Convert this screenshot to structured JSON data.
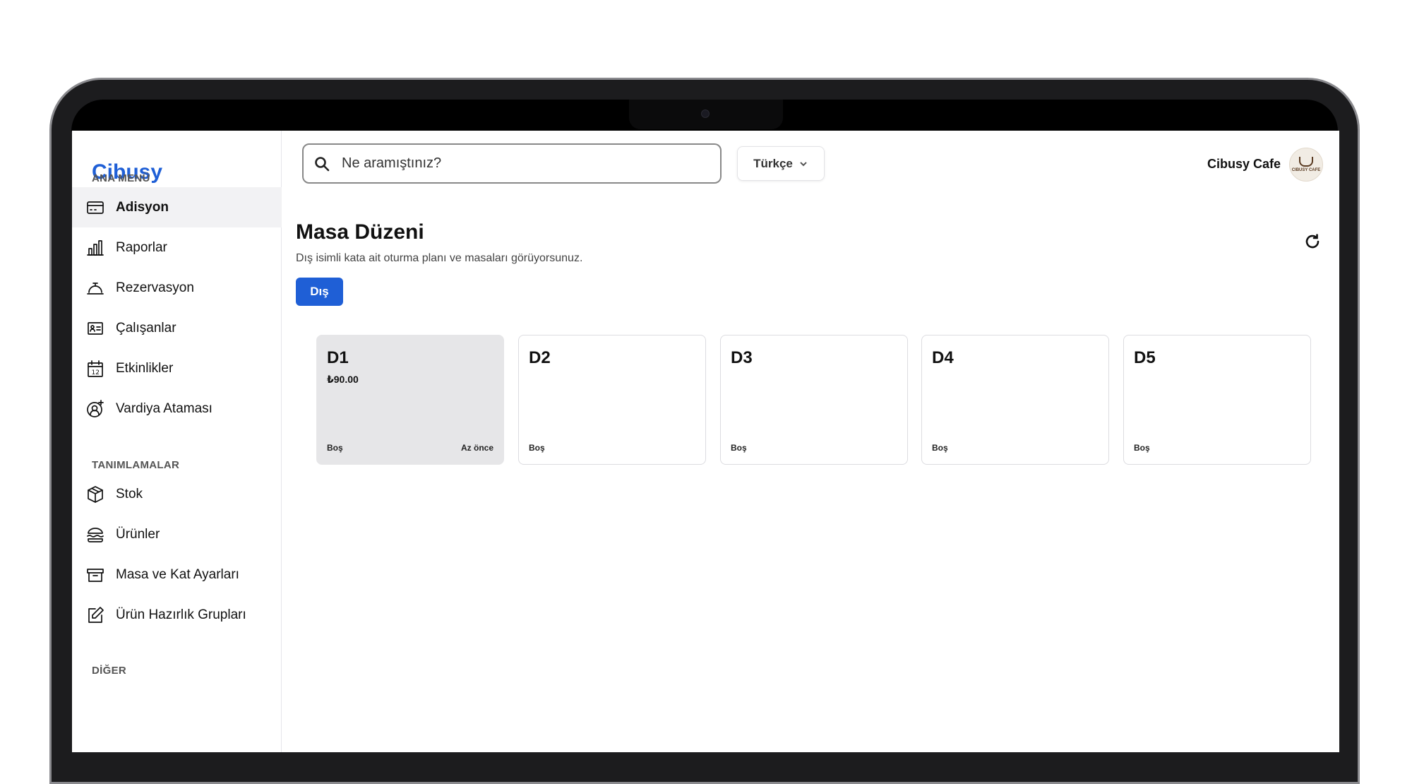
{
  "app": {
    "brand": "Cibusy"
  },
  "sidebar": {
    "sections": [
      {
        "title": "ANA MENÜ"
      },
      {
        "title": "TANIMLAMALAR"
      },
      {
        "title": "DİĞER"
      }
    ],
    "items": [
      {
        "label": "Adisyon",
        "icon": "receipt-card-icon",
        "active": true
      },
      {
        "label": "Raporlar",
        "icon": "bar-chart-icon"
      },
      {
        "label": "Rezervasyon",
        "icon": "service-bell-icon"
      },
      {
        "label": "Çalışanlar",
        "icon": "id-card-icon"
      },
      {
        "label": "Etkinlikler",
        "icon": "calendar-icon"
      },
      {
        "label": "Vardiya Ataması",
        "icon": "user-add-icon"
      },
      {
        "label": "Stok",
        "icon": "box-icon"
      },
      {
        "label": "Ürünler",
        "icon": "burger-icon"
      },
      {
        "label": "Masa ve Kat Ayarları",
        "icon": "archive-icon"
      },
      {
        "label": "Ürün Hazırlık Grupları",
        "icon": "edit-icon"
      }
    ]
  },
  "header": {
    "search": {
      "placeholder": "Ne aramıştınız?"
    },
    "language": "Türkçe",
    "user_name": "Cibusy Cafe",
    "avatar_logo_text": "CIBUSY CAFE"
  },
  "main": {
    "title": "Masa Düzeni",
    "subtitle": "Dış isimli kata ait oturma planı ve masaları görüyorsunuz.",
    "floor_tabs": [
      {
        "label": "Dış",
        "active": true
      }
    ],
    "tables": [
      {
        "name": "D1",
        "amount": "₺90.00",
        "status": "Boş",
        "time": "Az önce",
        "occupied": true
      },
      {
        "name": "D2",
        "amount": "",
        "status": "Boş",
        "time": ""
      },
      {
        "name": "D3",
        "amount": "",
        "status": "Boş",
        "time": ""
      },
      {
        "name": "D4",
        "amount": "",
        "status": "Boş",
        "time": ""
      },
      {
        "name": "D5",
        "amount": "",
        "status": "Boş",
        "time": ""
      }
    ]
  },
  "colors": {
    "accent": "#1f5fd6",
    "occupied_bg": "#e6e6e8"
  }
}
